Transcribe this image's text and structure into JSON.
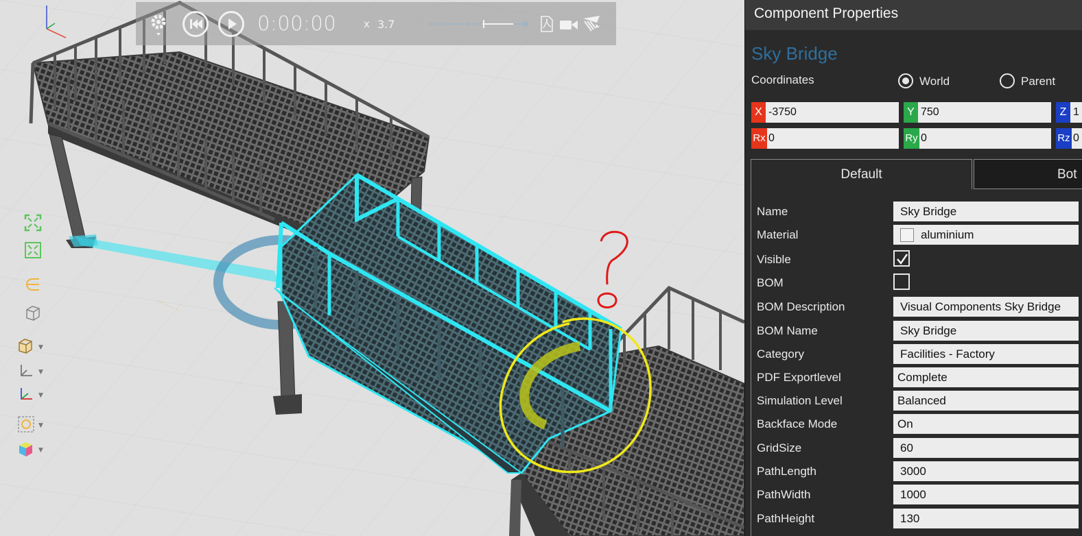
{
  "playback": {
    "time": "0:00:00",
    "speed_label": "x",
    "speed_value": "3.7"
  },
  "panel": {
    "title": "Component Properties",
    "component_name": "Sky Bridge",
    "coordinates_label": "Coordinates",
    "coord_modes": [
      {
        "label": "World",
        "selected": true
      },
      {
        "label": "Parent",
        "selected": false
      }
    ],
    "coords": {
      "x": {
        "tag": "X",
        "value": "-3750",
        "color": "#e5361c"
      },
      "y": {
        "tag": "Y",
        "value": "750",
        "color": "#2aa84a"
      },
      "z": {
        "tag": "Z",
        "value": "1",
        "color": "#1a3fc4"
      },
      "rx": {
        "tag": "Rx",
        "value": "0",
        "color": "#e5361c"
      },
      "ry": {
        "tag": "Ry",
        "value": "0",
        "color": "#2aa84a"
      },
      "rz": {
        "tag": "Rz",
        "value": "0",
        "color": "#1a3fc4"
      }
    },
    "tabs": [
      {
        "label": "Default",
        "active": true
      },
      {
        "label": "Bot",
        "active": false
      }
    ],
    "properties": [
      {
        "label": "Name",
        "value": "Sky Bridge",
        "kind": "text"
      },
      {
        "label": "Material",
        "value": "aluminium",
        "kind": "material"
      },
      {
        "label": "Visible",
        "checked": true,
        "kind": "check"
      },
      {
        "label": "BOM",
        "checked": false,
        "kind": "check"
      },
      {
        "label": "BOM Description",
        "value": "Visual Components Sky Bridge",
        "kind": "text"
      },
      {
        "label": "BOM Name",
        "value": "Sky Bridge",
        "kind": "text"
      },
      {
        "label": "Category",
        "value": "Facilities - Factory",
        "kind": "text"
      },
      {
        "label": "PDF Exportlevel",
        "value": "Complete",
        "kind": "text"
      },
      {
        "label": "Simulation Level",
        "value": "Balanced",
        "kind": "text"
      },
      {
        "label": "Backface Mode",
        "value": "On",
        "kind": "text"
      },
      {
        "label": "GridSize",
        "value": "60",
        "kind": "text"
      },
      {
        "label": "PathLength",
        "value": "3000",
        "kind": "text"
      },
      {
        "label": "PathWidth",
        "value": "1000",
        "kind": "text"
      },
      {
        "label": "PathHeight",
        "value": "130",
        "kind": "text"
      }
    ]
  },
  "colors": {
    "highlight": "#2ee6f2",
    "annotation_red": "#e01818",
    "annotation_yellow": "#f0e81a",
    "accent_blue": "#2e6f9e"
  },
  "icons": [
    "settings-gear-icon",
    "rewind-icon",
    "play-icon",
    "pdf-icon",
    "video-camera-icon",
    "render-icon",
    "axis-triad-icon",
    "fit-all-icon",
    "fit-selection-icon",
    "snap-icon",
    "box-icon",
    "box-dropdown-icon",
    "frame-dropdown-icon",
    "axes-dropdown-icon",
    "render-mode-icon",
    "color-cube-icon"
  ]
}
